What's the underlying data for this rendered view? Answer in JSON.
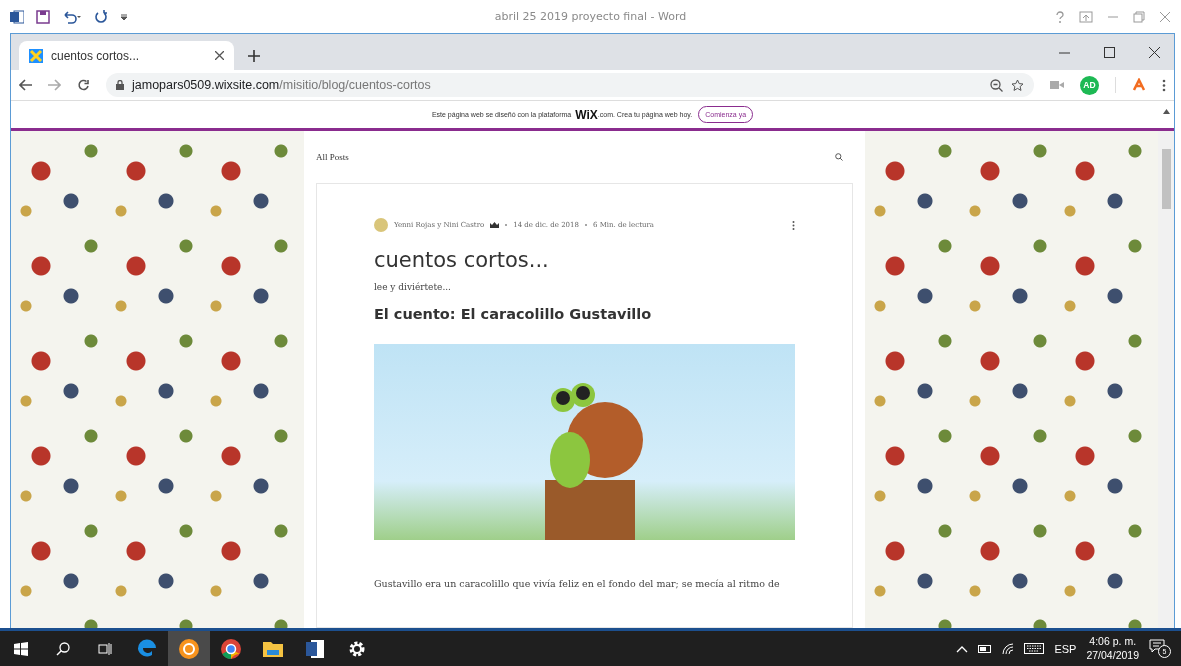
{
  "word_window": {
    "title": "abril 25 2019 proyecto final - Word"
  },
  "browser": {
    "tabs": [
      {
        "title": "cuentos cortos...",
        "selected": true
      }
    ],
    "address": {
      "host": "jamopars0509.wixsite.com",
      "path": "/misitio/blog/cuentos-cortos"
    },
    "extension_badge": "AD"
  },
  "wix_banner": {
    "before": "Este página web se diseñó con la plataforma",
    "logo": "WiX",
    "after": ".com. Crea tu página web hoy.",
    "button": "Comienza ya"
  },
  "blog": {
    "nav": "All Posts",
    "post": {
      "author": "Yenni Rojas y Nini Castro",
      "date": "14 de dic. de 2018",
      "read_time": "6 Min. de lectura",
      "title": "cuentos cortos...",
      "subtitle": "lee y diviértete...",
      "heading": "El cuento: El caracolillo Gustavillo",
      "body": "Gustavillo era un caracolillo que vivía feliz en el fondo del mar; se mecía al ritmo de"
    }
  },
  "taskbar": {
    "apps": [
      {
        "kind": "edge",
        "selected": false
      },
      {
        "kind": "orange",
        "selected": true
      },
      {
        "kind": "chrome",
        "selected": false
      },
      {
        "kind": "folder",
        "selected": false
      },
      {
        "kind": "word",
        "selected": false
      },
      {
        "kind": "settings",
        "selected": false
      }
    ],
    "language": "ESP",
    "time": "4:06 p. m.",
    "date": "27/04/2019",
    "notifications": "5"
  }
}
